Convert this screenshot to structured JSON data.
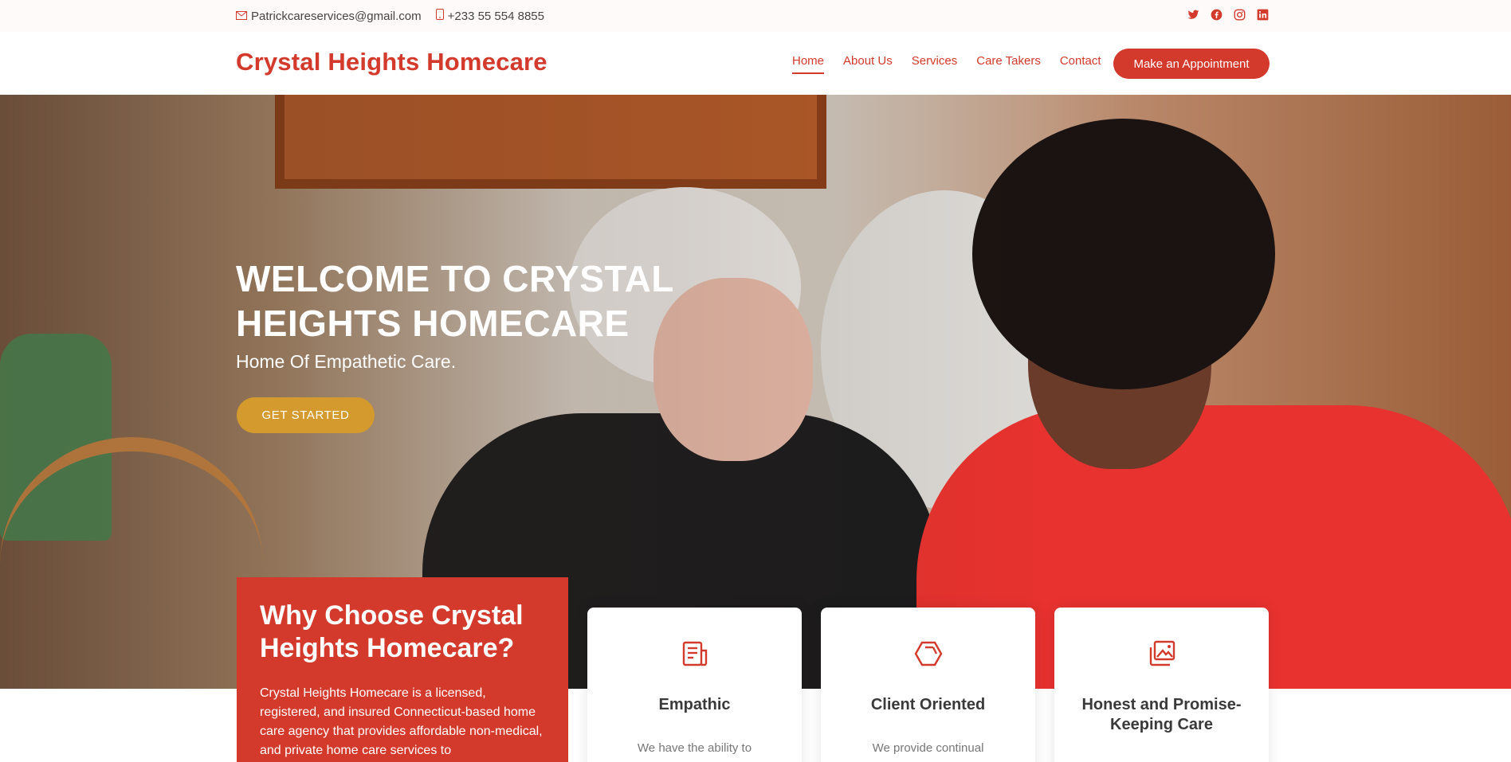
{
  "topbar": {
    "email": "Patrickcareservices@gmail.com",
    "phone": "+233 55 554 8855",
    "social_icons": [
      "twitter-icon",
      "facebook-icon",
      "instagram-icon",
      "linkedin-icon"
    ]
  },
  "header": {
    "logo": "Crystal Heights Homecare",
    "nav": [
      {
        "label": "Home",
        "active": true
      },
      {
        "label": "About Us"
      },
      {
        "label": "Services"
      },
      {
        "label": "Care Takers"
      },
      {
        "label": "Contact"
      }
    ],
    "cta": "Make an Appointment"
  },
  "hero": {
    "title": "WELCOME TO CRYSTAL HEIGHTS HOMECARE",
    "subtitle": "Home Of Empathetic Care.",
    "button": "GET STARTED"
  },
  "why": {
    "title": "Why Choose Crystal Heights Homecare?",
    "text": "Crystal Heights Homecare is a licensed, registered, and insured Connecticut-based home care agency that provides affordable non-medical, and private home care services to"
  },
  "cards": [
    {
      "icon": "document-icon",
      "title": "Empathic",
      "text": "We have the ability to"
    },
    {
      "icon": "hexagon-icon",
      "title": "Client Oriented",
      "text": "We provide continual"
    },
    {
      "icon": "images-icon",
      "title": "Honest and Promise-Keeping Care",
      "text": ""
    }
  ],
  "colors": {
    "brand": "#d33a2c",
    "accent": "#d49a2e"
  }
}
